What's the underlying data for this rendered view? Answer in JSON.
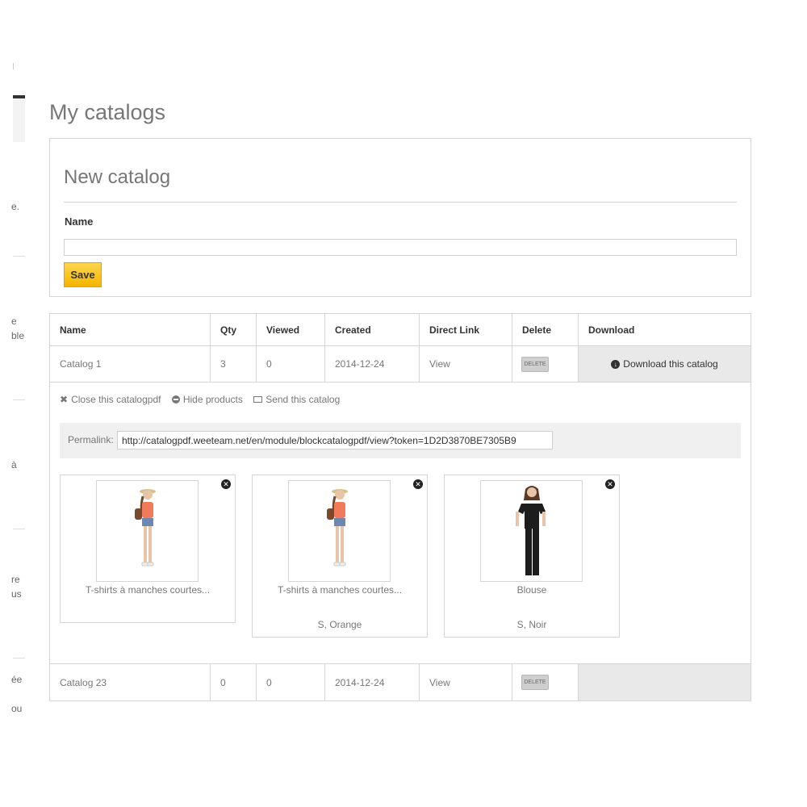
{
  "sidebar": {
    "fragments": [
      "e.",
      "e",
      "ble",
      "à",
      "re",
      "us",
      "ée",
      "ou"
    ]
  },
  "page": {
    "title": "My catalogs"
  },
  "new_catalog": {
    "title": "New catalog",
    "name_label": "Name",
    "name_value": "",
    "save_label": "Save"
  },
  "table": {
    "headers": [
      "Name",
      "Qty",
      "Viewed",
      "Created",
      "Direct Link",
      "Delete",
      "Download"
    ],
    "rows": [
      {
        "name": "Catalog 1",
        "qty": "3",
        "viewed": "0",
        "created": "2014-12-24",
        "link": "View",
        "delete": "DELETE",
        "download": "Download this catalog"
      },
      {
        "name": "Catalog 23",
        "qty": "0",
        "viewed": "0",
        "created": "2014-12-24",
        "link": "View",
        "delete": "DELETE",
        "download": ""
      }
    ]
  },
  "detail": {
    "close_label": "Close this catalogpdf",
    "hide_label": "Hide products",
    "send_label": "Send this catalog",
    "permalink_label": "Permalink:",
    "permalink_value": "http://catalogpdf.weeteam.net/en/module/blockcatalogpdf/view?token=1D2D3870BE7305B9",
    "products": [
      {
        "name": "T-shirts à manches courtes...",
        "attributes": ""
      },
      {
        "name": "T-shirts à manches courtes...",
        "attributes": "S, Orange"
      },
      {
        "name": "Blouse",
        "attributes": "S, Noir"
      }
    ]
  },
  "colors": {
    "save_button": "#f5b400",
    "row_highlight": "#e9e9e9",
    "border": "#d6d4d4"
  }
}
